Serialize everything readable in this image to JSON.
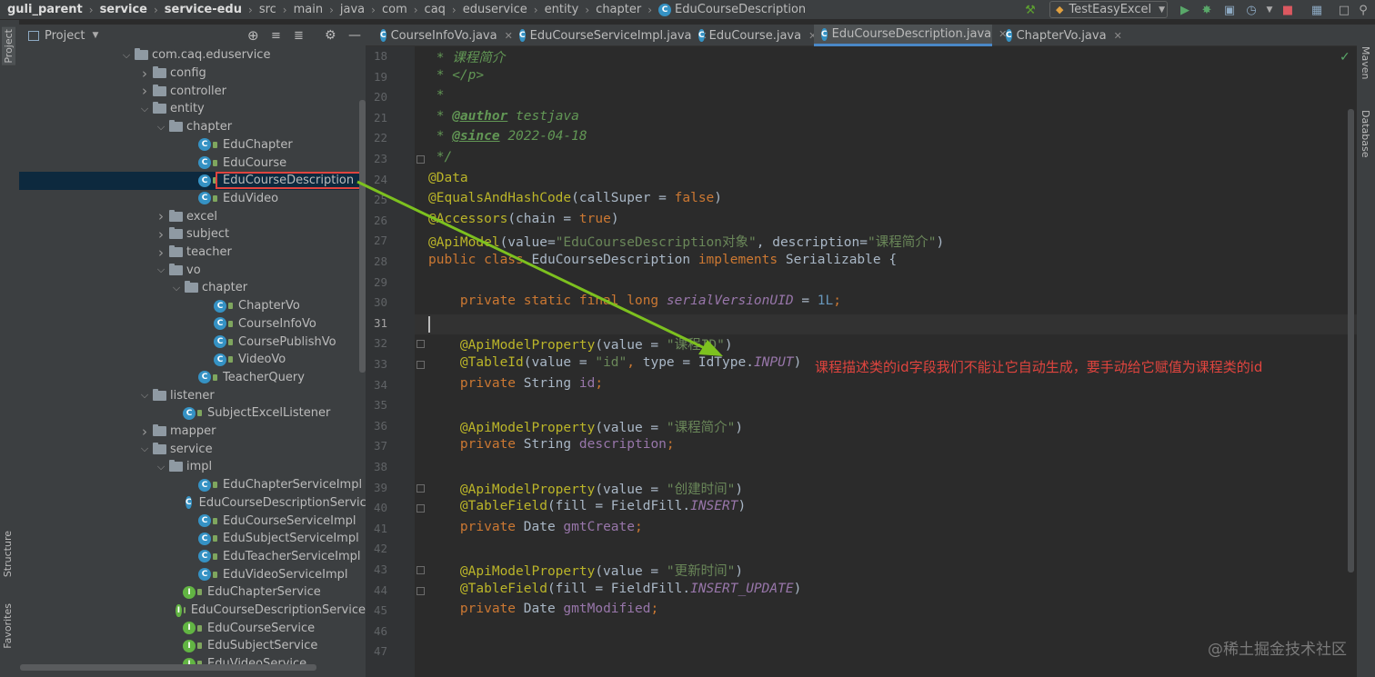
{
  "breadcrumbs": [
    "guli_parent",
    "service",
    "service-edu",
    "src",
    "main",
    "java",
    "com",
    "caq",
    "eduservice",
    "entity",
    "chapter",
    "EduCourseDescription"
  ],
  "run_config": "TestEasyExcel",
  "project_panel": {
    "title": "Project"
  },
  "left_strip": {
    "project": "Project",
    "structure": "Structure",
    "favorites": "Favorites"
  },
  "right_strip": {
    "maven": "Maven",
    "database": "Database"
  },
  "tree": [
    {
      "label": "com.caq.eduservice",
      "kind": "package",
      "state": "open"
    },
    {
      "label": "config",
      "kind": "folder",
      "state": "closed"
    },
    {
      "label": "controller",
      "kind": "folder",
      "state": "closed"
    },
    {
      "label": "entity",
      "kind": "folder",
      "state": "open"
    },
    {
      "label": "chapter",
      "kind": "folder",
      "state": "open"
    },
    {
      "label": "EduChapter",
      "kind": "class"
    },
    {
      "label": "EduCourse",
      "kind": "class"
    },
    {
      "label": "EduCourseDescription",
      "kind": "class",
      "selected": true
    },
    {
      "label": "EduVideo",
      "kind": "class"
    },
    {
      "label": "excel",
      "kind": "folder",
      "state": "closed"
    },
    {
      "label": "subject",
      "kind": "folder",
      "state": "closed"
    },
    {
      "label": "teacher",
      "kind": "folder",
      "state": "closed"
    },
    {
      "label": "vo",
      "kind": "folder",
      "state": "open"
    },
    {
      "label": "chapter",
      "kind": "folder",
      "state": "open"
    },
    {
      "label": "ChapterVo",
      "kind": "class"
    },
    {
      "label": "CourseInfoVo",
      "kind": "class"
    },
    {
      "label": "CoursePublishVo",
      "kind": "class"
    },
    {
      "label": "VideoVo",
      "kind": "class"
    },
    {
      "label": "TeacherQuery",
      "kind": "class"
    },
    {
      "label": "listener",
      "kind": "folder",
      "state": "open"
    },
    {
      "label": "SubjectExcelListener",
      "kind": "class"
    },
    {
      "label": "mapper",
      "kind": "folder",
      "state": "closed"
    },
    {
      "label": "service",
      "kind": "folder",
      "state": "open"
    },
    {
      "label": "impl",
      "kind": "folder",
      "state": "open"
    },
    {
      "label": "EduChapterServiceImpl",
      "kind": "class"
    },
    {
      "label": "EduCourseDescriptionServic",
      "kind": "class"
    },
    {
      "label": "EduCourseServiceImpl",
      "kind": "class"
    },
    {
      "label": "EduSubjectServiceImpl",
      "kind": "class"
    },
    {
      "label": "EduTeacherServiceImpl",
      "kind": "class"
    },
    {
      "label": "EduVideoServiceImpl",
      "kind": "class"
    },
    {
      "label": "EduChapterService",
      "kind": "interface"
    },
    {
      "label": "EduCourseDescriptionService",
      "kind": "interface"
    },
    {
      "label": "EduCourseService",
      "kind": "interface"
    },
    {
      "label": "EduSubjectService",
      "kind": "interface"
    },
    {
      "label": "EduVideoService",
      "kind": "interface"
    }
  ],
  "tabs": [
    {
      "label": "CourseInfoVo.java",
      "active": false
    },
    {
      "label": "EduCourseServiceImpl.java",
      "active": false
    },
    {
      "label": "EduCourse.java",
      "active": false
    },
    {
      "label": "EduCourseDescription.java",
      "active": true
    },
    {
      "label": "ChapterVo.java",
      "active": false
    }
  ],
  "editor": {
    "first_line": 18,
    "current_line": 31,
    "lines": [
      [
        [
          "cm",
          " * 课程简介"
        ]
      ],
      [
        [
          "cm",
          " * </p>"
        ]
      ],
      [
        [
          "cm",
          " *"
        ]
      ],
      [
        [
          "cm",
          " * "
        ],
        [
          "tagc",
          "@author"
        ],
        [
          "cm",
          " testjava"
        ]
      ],
      [
        [
          "cm",
          " * "
        ],
        [
          "tagc",
          "@since"
        ],
        [
          "cm",
          " 2022-04-18"
        ]
      ],
      [
        [
          "cm",
          " */"
        ]
      ],
      [
        [
          "an",
          "@Data"
        ]
      ],
      [
        [
          "an",
          "@EqualsAndHashCode"
        ],
        [
          "p",
          "(callSuper = "
        ],
        [
          "kw",
          "false"
        ],
        [
          "p",
          ")"
        ]
      ],
      [
        [
          "an",
          "@Accessors"
        ],
        [
          "p",
          "(chain = "
        ],
        [
          "kw",
          "true"
        ],
        [
          "p",
          ")"
        ]
      ],
      [
        [
          "an",
          "@ApiModel"
        ],
        [
          "p",
          "(value="
        ],
        [
          "st",
          "\"EduCourseDescription对象\""
        ],
        [
          "p",
          ", description="
        ],
        [
          "st",
          "\"课程简介\""
        ],
        [
          "p",
          ")"
        ]
      ],
      [
        [
          "kw",
          "public class "
        ],
        [
          "p",
          "EduCourseDescription "
        ],
        [
          "kw",
          "implements "
        ],
        [
          "p",
          "Serializable {"
        ]
      ],
      [],
      [
        [
          "p",
          "    "
        ],
        [
          "kw",
          "private static final long "
        ],
        [
          "cn",
          "serialVersionUID"
        ],
        [
          "p",
          " = "
        ],
        [
          "nm",
          "1L"
        ],
        [
          "kw",
          ";"
        ]
      ],
      [],
      [
        [
          "p",
          "    "
        ],
        [
          "an",
          "@ApiModelProperty"
        ],
        [
          "p",
          "(value = "
        ],
        [
          "st",
          "\"课程ID\""
        ],
        [
          "p",
          ")"
        ]
      ],
      [
        [
          "p",
          "    "
        ],
        [
          "an",
          "@TableId"
        ],
        [
          "p",
          "(value = "
        ],
        [
          "st",
          "\"id\""
        ],
        [
          "kw",
          ", "
        ],
        [
          "p",
          "type = IdType."
        ],
        [
          "cn",
          "INPUT"
        ],
        [
          "p",
          ")"
        ]
      ],
      [
        [
          "p",
          "    "
        ],
        [
          "kw",
          "private "
        ],
        [
          "p",
          "String "
        ],
        [
          "fd",
          "id"
        ],
        [
          "kw",
          ";"
        ]
      ],
      [],
      [
        [
          "p",
          "    "
        ],
        [
          "an",
          "@ApiModelProperty"
        ],
        [
          "p",
          "(value = "
        ],
        [
          "st",
          "\"课程简介\""
        ],
        [
          "p",
          ")"
        ]
      ],
      [
        [
          "p",
          "    "
        ],
        [
          "kw",
          "private "
        ],
        [
          "p",
          "String "
        ],
        [
          "fd",
          "description"
        ],
        [
          "kw",
          ";"
        ]
      ],
      [],
      [
        [
          "p",
          "    "
        ],
        [
          "an",
          "@ApiModelProperty"
        ],
        [
          "p",
          "(value = "
        ],
        [
          "st",
          "\"创建时间\""
        ],
        [
          "p",
          ")"
        ]
      ],
      [
        [
          "p",
          "    "
        ],
        [
          "an",
          "@TableField"
        ],
        [
          "p",
          "(fill = FieldFill."
        ],
        [
          "cn",
          "INSERT"
        ],
        [
          "p",
          ")"
        ]
      ],
      [
        [
          "p",
          "    "
        ],
        [
          "kw",
          "private "
        ],
        [
          "p",
          "Date "
        ],
        [
          "fd",
          "gmtCreate"
        ],
        [
          "kw",
          ";"
        ]
      ],
      [],
      [
        [
          "p",
          "    "
        ],
        [
          "an",
          "@ApiModelProperty"
        ],
        [
          "p",
          "(value = "
        ],
        [
          "st",
          "\"更新时间\""
        ],
        [
          "p",
          ")"
        ]
      ],
      [
        [
          "p",
          "    "
        ],
        [
          "an",
          "@TableField"
        ],
        [
          "p",
          "(fill = FieldFill."
        ],
        [
          "cn",
          "INSERT_UPDATE"
        ],
        [
          "p",
          ")"
        ]
      ],
      [
        [
          "p",
          "    "
        ],
        [
          "kw",
          "private "
        ],
        [
          "p",
          "Date "
        ],
        [
          "fd",
          "gmtModified"
        ],
        [
          "kw",
          ";"
        ]
      ],
      [],
      []
    ]
  },
  "annotation_text": "课程描述类的id字段我们不能让它自动生成，要手动给它赋值为课程类的id",
  "watermark": "@稀土掘金技术社区",
  "colors": {
    "annotation": "#e0443e",
    "arrow": "#7dc11f",
    "selection": "#0d293e",
    "accent": "#4a88c7"
  }
}
